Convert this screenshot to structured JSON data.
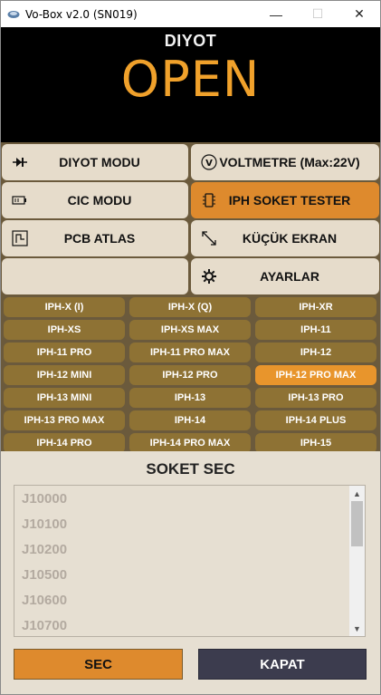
{
  "window": {
    "title": "Vo-Box v2.0 (SN019)",
    "minimize": "—",
    "maximize": "☐",
    "close": "✕"
  },
  "display": {
    "mode": "DIYOT",
    "status": "OPEN",
    "status_color": "#f0a12b"
  },
  "menu": {
    "diyot_modu": "DIYOT MODU",
    "voltmetre": "VOLTMETRE (Max:22V)",
    "cic_modu": "CIC MODU",
    "iph_soket_tester": "IPH SOKET TESTER",
    "pcb_atlas": "PCB ATLAS",
    "kucuk_ekran": "KÜÇÜK EKRAN",
    "ayarlar": "AYARLAR",
    "voltmetre_icon_letter": "V"
  },
  "sockets": [
    "IPH-X (I)",
    "IPH-X (Q)",
    "IPH-XR",
    "IPH-XS",
    "IPH-XS MAX",
    "IPH-11",
    "IPH-11 PRO",
    "IPH-11 PRO MAX",
    "IPH-12",
    "IPH-12 MINI",
    "IPH-12 PRO",
    "IPH-12 PRO MAX",
    "IPH-13 MINI",
    "IPH-13",
    "IPH-13 PRO",
    "IPH-13 PRO MAX",
    "IPH-14",
    "IPH-14 PLUS",
    "IPH-14 PRO",
    "IPH-14 PRO MAX",
    "IPH-15"
  ],
  "selected_socket": "IPH-12 PRO MAX",
  "selector": {
    "title": "SOKET SEC",
    "items": [
      "J10000",
      "J10100",
      "J10200",
      "J10500",
      "J10600",
      "J10700"
    ],
    "sec_label": "SEC",
    "kapat_label": "KAPAT"
  },
  "colors": {
    "accent_orange": "#de8a2d",
    "socket_button": "#8e7234",
    "panel_bg": "#6b5a3c",
    "menu_button": "#e6dccb",
    "kapat_button": "#3c3c4e"
  }
}
